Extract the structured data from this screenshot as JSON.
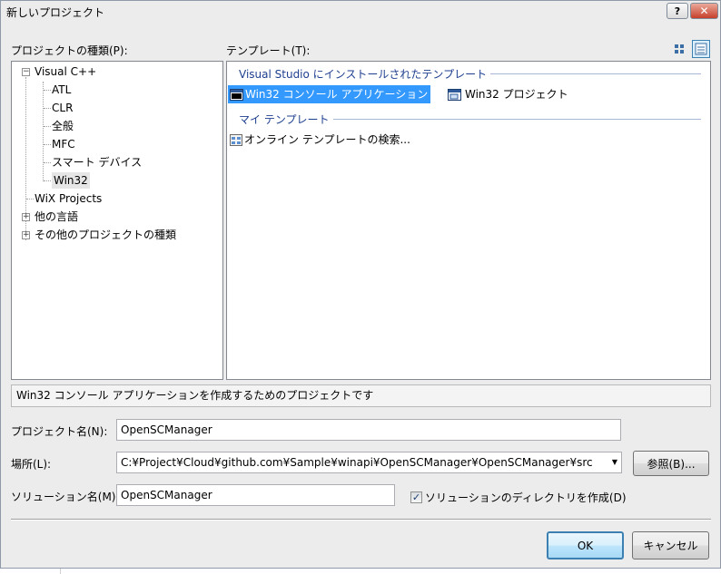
{
  "window": {
    "title": "新しいプロジェクト",
    "help_label": "?",
    "close_label": "✕"
  },
  "project_types": {
    "label": "プロジェクトの種類(P):",
    "tree": [
      {
        "label": "Visual C++",
        "expander": "⊟"
      },
      {
        "label": "ATL"
      },
      {
        "label": "CLR"
      },
      {
        "label": "全般"
      },
      {
        "label": "MFC"
      },
      {
        "label": "スマート デバイス"
      },
      {
        "label": "Win32"
      },
      {
        "label": "WiX Projects"
      },
      {
        "label": "他の言語",
        "expander": "⊞"
      },
      {
        "label": "その他のプロジェクトの種類",
        "expander": "⊞"
      }
    ]
  },
  "templates": {
    "label": "テンプレート(T):",
    "groups": [
      {
        "header": "Visual Studio にインストールされたテンプレート",
        "items": [
          "Win32 コンソール アプリケーション",
          "Win32 プロジェクト"
        ]
      },
      {
        "header": "マイ テンプレート",
        "items": [
          "オンライン テンプレートの検索..."
        ]
      }
    ]
  },
  "description": "Win32 コンソール アプリケーションを作成するためのプロジェクトです",
  "form": {
    "name_label": "プロジェクト名(N):",
    "name_value": "OpenSCManager",
    "location_label": "場所(L):",
    "location_value": "C:¥Project¥Cloud¥github.com¥Sample¥winapi¥OpenSCManager¥OpenSCManager¥src",
    "browse_label": "参照(B)...",
    "solution_label": "ソリューション名(M)",
    "solution_value": "OpenSCManager",
    "create_dir_label": "ソリューションのディレクトリを作成(D)",
    "create_dir_checked": true
  },
  "buttons": {
    "ok": "OK",
    "cancel": "キャンセル"
  },
  "colors": {
    "selection": "#3399ff",
    "group_header": "#1e3f8f"
  }
}
